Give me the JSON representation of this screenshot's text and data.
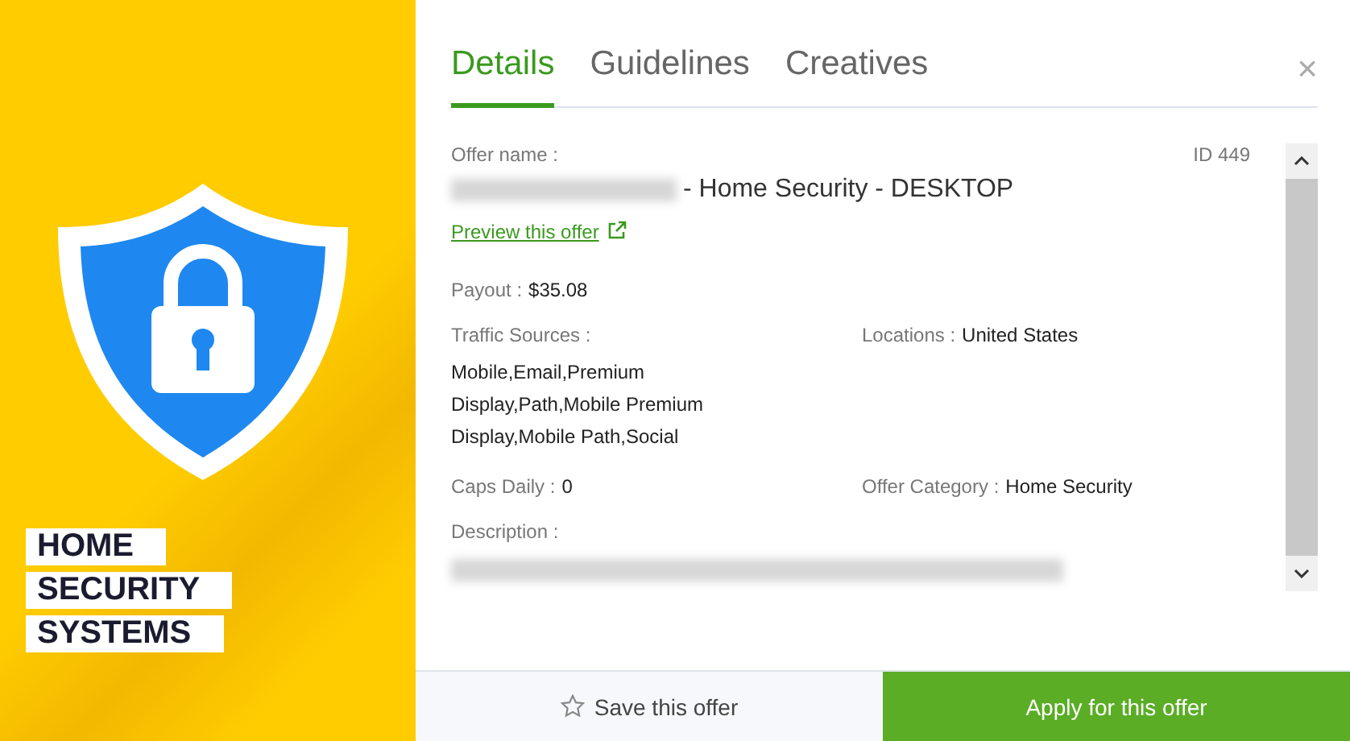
{
  "banner": {
    "lines": [
      "HOME",
      "SECURITY",
      "SYSTEMS"
    ]
  },
  "tabs": [
    {
      "label": "Details",
      "selected": true
    },
    {
      "label": "Guidelines",
      "selected": false
    },
    {
      "label": "Creatives",
      "selected": false
    }
  ],
  "close": "×",
  "offer": {
    "name_label": "Offer name :",
    "id": "ID 449",
    "name": "- Home Security - DESKTOP",
    "preview_link": "Preview this offer",
    "fields": [
      {
        "label": "Payout :",
        "value": "$35.08",
        "kind": "full"
      },
      {
        "label": "Traffic Sources :",
        "value": "Mobile,Email,Premium Display,Path,Mobile Premium Display,Mobile Path,Social",
        "kind": "list"
      },
      {
        "label": "Locations :",
        "value": "United States",
        "kind": "half"
      },
      {
        "label": "Caps Daily :",
        "value": "0",
        "kind": "half"
      },
      {
        "label": "Offer Category :",
        "value": "Home Security",
        "kind": "half"
      }
    ],
    "description_label": "Description :"
  },
  "buttons": [
    {
      "kind": "secondary",
      "label": "Save this offer"
    },
    {
      "kind": "primary",
      "label": "Apply for this offer"
    }
  ]
}
